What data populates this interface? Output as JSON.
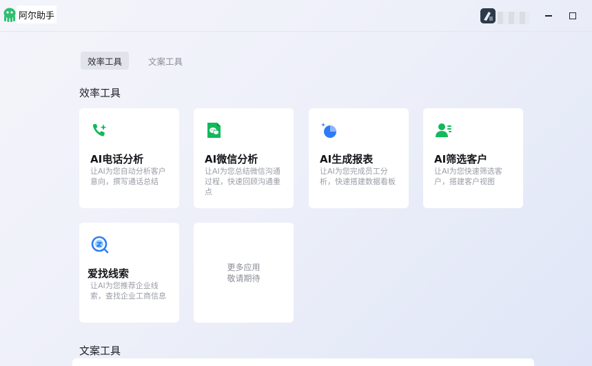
{
  "app": {
    "title": "阿尔助手"
  },
  "tabs": [
    {
      "label": "效率工具",
      "active": true
    },
    {
      "label": "文案工具",
      "active": false
    }
  ],
  "sections": {
    "efficiency_title": "效率工具",
    "copywriting_title": "文案工具"
  },
  "cards": [
    {
      "name": "AI电话分析",
      "desc": "让AI为您自动分析客户意向，撰写通话总结",
      "icon": "phone-sparkle-icon"
    },
    {
      "name": "AI微信分析",
      "desc": "让AI为您总结微信沟通过程，快速回顾沟通重点",
      "icon": "wechat-icon"
    },
    {
      "name": "AI生成报表",
      "desc": "让AI为您完成员工分析，快速搭建数据看板",
      "icon": "pie-chart-icon"
    },
    {
      "name": "AI筛选客户",
      "desc": "让AI为您快速筛选客户，搭建客户视图",
      "icon": "user-filter-icon"
    },
    {
      "name": "爱找线索",
      "desc": "让AI为您推荐企业线索，查找企业工商信息",
      "icon": "search-clue-icon"
    }
  ],
  "more": {
    "line1": "更多应用",
    "line2": "敬请期待"
  },
  "colors": {
    "accent_green": "#13b95a",
    "accent_blue": "#2d7cf6"
  }
}
